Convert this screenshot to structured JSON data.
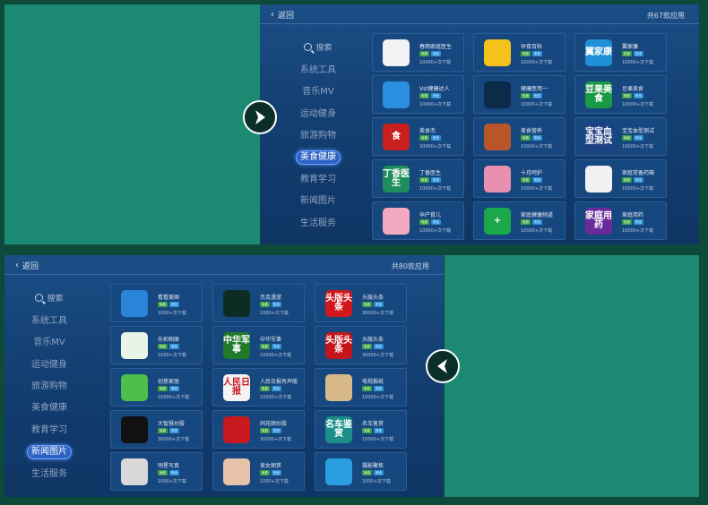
{
  "colors": {
    "background": "#0e4a3a",
    "panel": "#1c8a72",
    "accent": "#2d63c2"
  },
  "top_screen": {
    "back_label": "返回",
    "count_label": "共67款应用",
    "search_label": "搜索",
    "categories": [
      "系统工具",
      "音乐MV",
      "运动健身",
      "旅游购物",
      "美食健康",
      "教育学习",
      "新闻图片",
      "生活服务"
    ],
    "active_category": "美食健康",
    "apps": [
      {
        "name": "春雨家庭医生",
        "downloads": "10000+次下载",
        "icon_text": "",
        "icon": "petals-icon",
        "color": "#f2f2f2",
        "tag1": "免费",
        "tag2": "安全"
      },
      {
        "name": "孕育百科",
        "downloads": "10000+次下载",
        "icon_text": "",
        "icon": "face-icon",
        "color": "#f4c21b",
        "tag1": "免费",
        "tag2": "安全"
      },
      {
        "name": "翼家康",
        "downloads": "10000+次下载",
        "icon_text": "翼家康",
        "icon": "house-cloud-icon",
        "color": "#1f8fd6",
        "tag1": "免费",
        "tag2": "安全"
      },
      {
        "name": "Vst健康达人",
        "downloads": "10000+次下载",
        "icon_text": "",
        "icon": "hand-heart-icon",
        "color": "#2a8fe0",
        "tag1": "免费",
        "tag2": "安全"
      },
      {
        "name": "健康医用一",
        "downloads": "10000+次下载",
        "icon_text": "",
        "icon": "flower-icon",
        "color": "#0c2a4a",
        "tag1": "免费",
        "tag2": "安全"
      },
      {
        "name": "豆果美食",
        "downloads": "10000+次下载",
        "icon_text": "豆果美食",
        "icon": "food-icon",
        "color": "#1b9a45",
        "tag1": "免费",
        "tag2": "安全"
      },
      {
        "name": "美食杰",
        "downloads": "30000+次下载",
        "icon_text": "食",
        "icon": "food-char-icon",
        "color": "#c9201f",
        "tag1": "免费",
        "tag2": "安全"
      },
      {
        "name": "美食营养",
        "downloads": "10000+次下载",
        "icon_text": "",
        "icon": "plate-icon",
        "color": "#b8562a",
        "tag1": "免费",
        "tag2": "安全"
      },
      {
        "name": "宝宝血型测试",
        "downloads": "10000+次下载",
        "icon_text": "宝宝血型测试",
        "icon": "blood-drop-icon",
        "color": "#1f3f86",
        "tag1": "免费",
        "tag2": "安全"
      },
      {
        "name": "丁香医生",
        "downloads": "10000+次下载",
        "icon_text": "丁香医生",
        "icon": "doctor-house-icon",
        "color": "#1e8e5c",
        "tag1": "免费",
        "tag2": "安全"
      },
      {
        "name": "十月呵护",
        "downloads": "10000+次下载",
        "icon_text": "",
        "icon": "bottles-icon",
        "color": "#e98fb0",
        "tag1": "免费",
        "tag2": "安全"
      },
      {
        "name": "家庭常备药箱",
        "downloads": "10000+次下载",
        "icon_text": "",
        "icon": "medkit-icon",
        "color": "#f1f1f1",
        "tag1": "免费",
        "tag2": "安全"
      },
      {
        "name": "孕产育儿",
        "downloads": "10000+次下载",
        "icon_text": "",
        "icon": "mother-icon",
        "color": "#f3a9c0",
        "tag1": "免费",
        "tag2": "安全"
      },
      {
        "name": "家庭健康频道",
        "downloads": "10000+次下载",
        "icon_text": "+",
        "icon": "green-cross-icon",
        "color": "#1aa84a",
        "tag1": "免费",
        "tag2": "安全"
      },
      {
        "name": "家庭用药",
        "downloads": "10000+次下载",
        "icon_text": "家庭用药",
        "icon": "leaf-icon",
        "color": "#6a2a9a",
        "tag1": "免费",
        "tag2": "安全"
      }
    ]
  },
  "bottom_screen": {
    "back_label": "返回",
    "count_label": "共80款应用",
    "search_label": "搜索",
    "categories": [
      "系统工具",
      "音乐MV",
      "运动健身",
      "旅游购物",
      "美食健康",
      "教育学习",
      "新闻图片",
      "生活服务"
    ],
    "active_category": "新闻图片",
    "apps": [
      {
        "name": "看看美图",
        "downloads": "1000+次下载",
        "icon_text": "",
        "icon": "picture-icon",
        "color": "#2a84d8",
        "tag1": "免费",
        "tag2": "安全"
      },
      {
        "name": "杰克漫游",
        "downloads": "1000+次下载",
        "icon_text": "",
        "icon": "planet-icon",
        "color": "#0d2d24",
        "tag1": "免费",
        "tag2": "安全"
      },
      {
        "name": "头版头条",
        "downloads": "30000+次下载",
        "icon_text": "头版头条",
        "icon": "headline-icon",
        "color": "#d0181c",
        "tag1": "免费",
        "tag2": "安全"
      },
      {
        "name": "乐拍相册",
        "downloads": "1000+次下载",
        "icon_text": "",
        "icon": "leaf-circle-icon",
        "color": "#e8f4e6",
        "tag1": "免费",
        "tag2": "安全"
      },
      {
        "name": "中华军事",
        "downloads": "10000+次下载",
        "icon_text": "中华军事",
        "icon": "military-icon",
        "color": "#1f7a2a",
        "tag1": "免费",
        "tag2": "安全"
      },
      {
        "name": "头版头条",
        "downloads": "30000+次下载",
        "icon_text": "头版头条",
        "icon": "headline-icon",
        "color": "#c4151a",
        "tag1": "免费",
        "tag2": "安全"
      },
      {
        "name": "创意家居",
        "downloads": "10000+次下载",
        "icon_text": "",
        "icon": "sofa-icon",
        "color": "#4cc04a",
        "tag1": "免费",
        "tag2": "安全"
      },
      {
        "name": "人民日报有声版",
        "downloads": "10000+次下载",
        "icon_text": "人民日报",
        "icon": "newspaper-red-icon",
        "color": "#f3f3f3",
        "tag1": "免费",
        "tag2": "安全"
      },
      {
        "name": "电视报纸",
        "downloads": "10000+次下载",
        "icon_text": "",
        "icon": "newspaper-icon",
        "color": "#d9b98a",
        "tag1": "免费",
        "tag2": "安全"
      },
      {
        "name": "大智慧炒股",
        "downloads": "30000+次下载",
        "icon_text": "",
        "icon": "stock-icon",
        "color": "#111111",
        "tag1": "免费",
        "tag2": "安全"
      },
      {
        "name": "同花顺炒股",
        "downloads": "30000+次下载",
        "icon_text": "",
        "icon": "stock-red-icon",
        "color": "#c8191f",
        "tag1": "免费",
        "tag2": "安全"
      },
      {
        "name": "名车鉴赏",
        "downloads": "10000+次下载",
        "icon_text": "名车鉴赏",
        "icon": "car-icon",
        "color": "#1c8f8a",
        "tag1": "免费",
        "tag2": "安全"
      },
      {
        "name": "明星写真",
        "downloads": "1000+次下载",
        "icon_text": "",
        "icon": "portrait-icon",
        "color": "#d8d8d8",
        "tag1": "免费",
        "tag2": "安全"
      },
      {
        "name": "美女图赏",
        "downloads": "1000+次下载",
        "icon_text": "",
        "icon": "portrait-icon",
        "color": "#e6c2a8",
        "tag1": "免费",
        "tag2": "安全"
      },
      {
        "name": "摄影聚焦",
        "downloads": "1000+次下载",
        "icon_text": "",
        "icon": "camera-icon",
        "color": "#2a9ee0",
        "tag1": "免费",
        "tag2": "安全"
      }
    ]
  }
}
